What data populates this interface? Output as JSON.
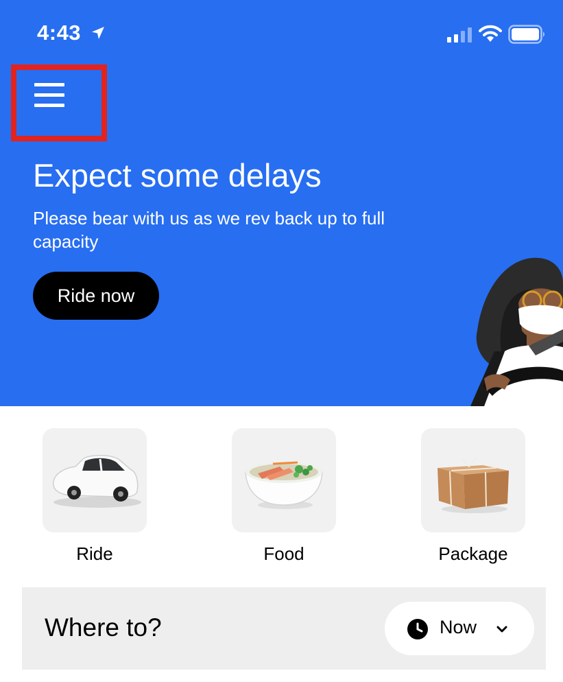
{
  "status_bar": {
    "time": "4:43"
  },
  "hero": {
    "title": "Expect some delays",
    "subtitle": "Please bear with us as we rev back up to full capacity",
    "cta_label": "Ride now",
    "background_color": "#276EF1"
  },
  "services": [
    {
      "label": "Ride",
      "icon": "car-icon"
    },
    {
      "label": "Food",
      "icon": "food-bowl-icon"
    },
    {
      "label": "Package",
      "icon": "package-box-icon"
    }
  ],
  "search": {
    "placeholder": "Where to?",
    "schedule_label": "Now"
  },
  "colors": {
    "highlight": "#E3231E",
    "accent": "#276EF1"
  }
}
